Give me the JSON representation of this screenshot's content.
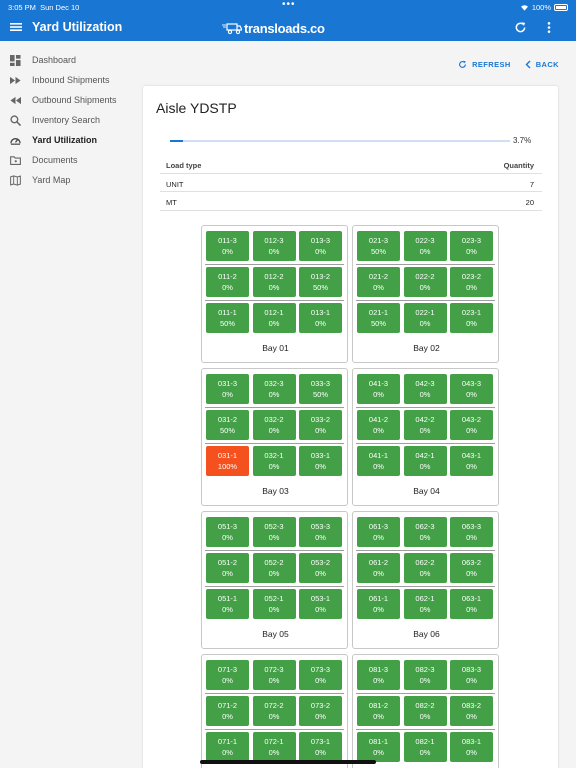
{
  "status": {
    "time": "3:05 PM",
    "date": "Sun Dec 10",
    "battery": "100%"
  },
  "appbar": {
    "title": "Yard Utilization",
    "logo": "transloads.co"
  },
  "sidebar": {
    "items": [
      {
        "label": "Dashboard",
        "icon": "dashboard-icon"
      },
      {
        "label": "Inbound Shipments",
        "icon": "fast-forward-icon"
      },
      {
        "label": "Outbound Shipments",
        "icon": "rewind-icon"
      },
      {
        "label": "Inventory Search",
        "icon": "search-icon"
      },
      {
        "label": "Yard Utilization",
        "icon": "speedometer-icon"
      },
      {
        "label": "Documents",
        "icon": "folder-icon"
      },
      {
        "label": "Yard Map",
        "icon": "map-icon"
      }
    ],
    "active_index": 4
  },
  "actions": {
    "refresh": "REFRESH",
    "back": "BACK"
  },
  "aisle": {
    "title": "Aisle YDSTP",
    "utilization_label": "3.7%",
    "utilization": 0.037
  },
  "load_table": {
    "headers": [
      "Load type",
      "Quantity"
    ],
    "rows": [
      [
        "UNIT",
        "7"
      ],
      [
        "MT",
        "20"
      ]
    ]
  },
  "bays": [
    {
      "label": "Bay 01",
      "rows": [
        [
          [
            "011-3",
            "0%"
          ],
          [
            "012-3",
            "0%"
          ],
          [
            "013-3",
            "0%"
          ]
        ],
        [
          [
            "011-2",
            "0%"
          ],
          [
            "012-2",
            "0%"
          ],
          [
            "013-2",
            "50%"
          ]
        ],
        [
          [
            "011-1",
            "50%"
          ],
          [
            "012-1",
            "0%"
          ],
          [
            "013-1",
            "0%"
          ]
        ]
      ]
    },
    {
      "label": "Bay 02",
      "rows": [
        [
          [
            "021-3",
            "50%"
          ],
          [
            "022-3",
            "0%"
          ],
          [
            "023-3",
            "0%"
          ]
        ],
        [
          [
            "021-2",
            "0%"
          ],
          [
            "022-2",
            "0%"
          ],
          [
            "023-2",
            "0%"
          ]
        ],
        [
          [
            "021-1",
            "50%"
          ],
          [
            "022-1",
            "0%"
          ],
          [
            "023-1",
            "0%"
          ]
        ]
      ]
    },
    {
      "label": "Bay 03",
      "rows": [
        [
          [
            "031-3",
            "0%"
          ],
          [
            "032-3",
            "0%"
          ],
          [
            "033-3",
            "50%"
          ]
        ],
        [
          [
            "031-2",
            "50%"
          ],
          [
            "032-2",
            "0%"
          ],
          [
            "033-2",
            "0%"
          ]
        ],
        [
          [
            "031-1",
            "100%"
          ],
          [
            "032-1",
            "0%"
          ],
          [
            "033-1",
            "0%"
          ]
        ]
      ]
    },
    {
      "label": "Bay 04",
      "rows": [
        [
          [
            "041-3",
            "0%"
          ],
          [
            "042-3",
            "0%"
          ],
          [
            "043-3",
            "0%"
          ]
        ],
        [
          [
            "041-2",
            "0%"
          ],
          [
            "042-2",
            "0%"
          ],
          [
            "043-2",
            "0%"
          ]
        ],
        [
          [
            "041-1",
            "0%"
          ],
          [
            "042-1",
            "0%"
          ],
          [
            "043-1",
            "0%"
          ]
        ]
      ]
    },
    {
      "label": "Bay 05",
      "rows": [
        [
          [
            "051-3",
            "0%"
          ],
          [
            "052-3",
            "0%"
          ],
          [
            "053-3",
            "0%"
          ]
        ],
        [
          [
            "051-2",
            "0%"
          ],
          [
            "052-2",
            "0%"
          ],
          [
            "053-2",
            "0%"
          ]
        ],
        [
          [
            "051-1",
            "0%"
          ],
          [
            "052-1",
            "0%"
          ],
          [
            "053-1",
            "0%"
          ]
        ]
      ]
    },
    {
      "label": "Bay 06",
      "rows": [
        [
          [
            "061-3",
            "0%"
          ],
          [
            "062-3",
            "0%"
          ],
          [
            "063-3",
            "0%"
          ]
        ],
        [
          [
            "061-2",
            "0%"
          ],
          [
            "062-2",
            "0%"
          ],
          [
            "063-2",
            "0%"
          ]
        ],
        [
          [
            "061-1",
            "0%"
          ],
          [
            "062-1",
            "0%"
          ],
          [
            "063-1",
            "0%"
          ]
        ]
      ]
    },
    {
      "label": "",
      "rows": [
        [
          [
            "071-3",
            "0%"
          ],
          [
            "072-3",
            "0%"
          ],
          [
            "073-3",
            "0%"
          ]
        ],
        [
          [
            "071-2",
            "0%"
          ],
          [
            "072-2",
            "0%"
          ],
          [
            "073-2",
            "0%"
          ]
        ],
        [
          [
            "071-1",
            "0%"
          ],
          [
            "072-1",
            "0%"
          ],
          [
            "073-1",
            "0%"
          ]
        ]
      ]
    },
    {
      "label": "",
      "rows": [
        [
          [
            "081-3",
            "0%"
          ],
          [
            "082-3",
            "0%"
          ],
          [
            "083-3",
            "0%"
          ]
        ],
        [
          [
            "081-2",
            "0%"
          ],
          [
            "082-2",
            "0%"
          ],
          [
            "083-2",
            "0%"
          ]
        ],
        [
          [
            "081-1",
            "0%"
          ],
          [
            "082-1",
            "0%"
          ],
          [
            "083-1",
            "0%"
          ]
        ]
      ]
    }
  ],
  "colors": {
    "primary": "#1976d2",
    "slot_ok": "#43a047",
    "slot_full": "#f4511e"
  }
}
